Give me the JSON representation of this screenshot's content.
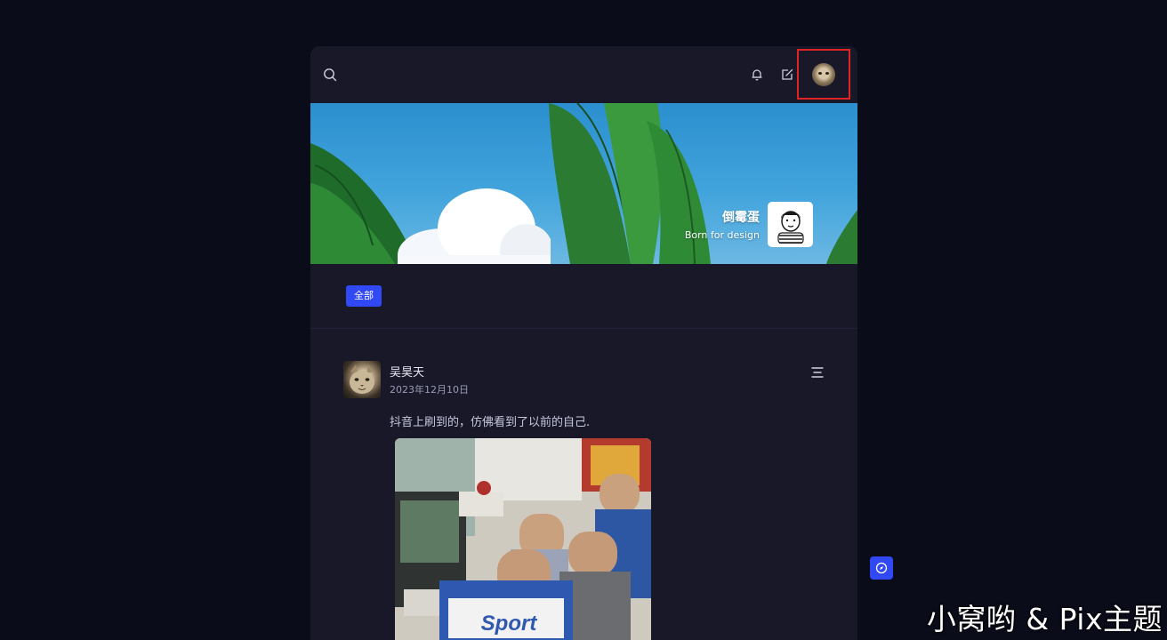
{
  "header": {
    "icons": [
      "search-icon",
      "bell-icon",
      "edit-icon",
      "user-avatar"
    ]
  },
  "banner": {
    "name": "倒霉蛋",
    "slogan": "Born for design"
  },
  "filter": {
    "active_label": "全部"
  },
  "post": {
    "author": "吴昊天",
    "date": "2023年12月10日",
    "text": "抖音上刷到的，仿佛看到了以前的自己.",
    "image_caption": "Sport"
  },
  "watermark": "小窝哟 & Pix主题",
  "colors": {
    "background": "#0b0c1a",
    "panel": "#181829",
    "accent": "#3148f5",
    "highlight_box": "#e02424"
  }
}
